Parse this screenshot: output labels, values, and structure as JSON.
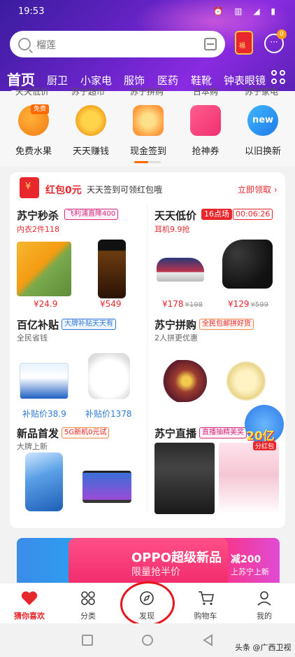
{
  "status": {
    "time": "19:53",
    "icons": "⏰ ▥ ◢ ▮"
  },
  "header": {
    "search_placeholder": "榴莲",
    "gift_label": "福",
    "msg_badge": "0"
  },
  "categories": [
    {
      "label": "首页"
    },
    {
      "label": "厨卫"
    },
    {
      "label": "小家电"
    },
    {
      "label": "服饰"
    },
    {
      "label": "医药"
    },
    {
      "label": "鞋靴"
    },
    {
      "label": "钟表眼镜"
    }
  ],
  "quick_top": [
    "天天低价",
    "苏宁超市",
    "苏宁拼购",
    "日本购",
    "苏宁家电"
  ],
  "quick": [
    {
      "label": "免费水果",
      "badge": "免费",
      "icon": "orange-fruit-icon"
    },
    {
      "label": "天天赚钱",
      "icon": "gold-coin-icon"
    },
    {
      "label": "现金签到",
      "icon": "diamond-icon"
    },
    {
      "label": "抢神券",
      "icon": "coupon-icon"
    },
    {
      "label": "以旧换新",
      "badge": "new",
      "icon": "new-icon"
    }
  ],
  "redpacket": {
    "amount": "红包0元",
    "text": "天天签到可领红包哦",
    "link": "立即领取 ›"
  },
  "sections": {
    "miaosha": {
      "title": "苏宁秒杀",
      "tag": "飞利浦直降400",
      "sub": "内衣2件118",
      "p1": "¥24.9",
      "p2": "¥549"
    },
    "dijia": {
      "title": "天天低价",
      "tag1": "16点场",
      "tag2": "00:06:26",
      "sub": "耳机9.9抢",
      "p1": "¥178",
      "o1": "¥198",
      "p2": "¥129",
      "o2": "¥599"
    },
    "butie": {
      "title": "百亿补贴",
      "tag": "大牌补贴天天有",
      "sub": "全民省钱",
      "p1": "补贴价38.9",
      "p2": "补贴价1378"
    },
    "pingou": {
      "title": "苏宁拼购",
      "tag": "全民包邮拼好货",
      "sub": "2人拼更优惠"
    },
    "shoufa": {
      "title": "新品首发",
      "tag": "5G新机0元试",
      "sub": "大牌上新"
    },
    "zhibo": {
      "title": "苏宁直播",
      "tag": "直播抽精美奖"
    }
  },
  "float_badge": {
    "text": "20亿",
    "sub": "分红包"
  },
  "promo": {
    "title": "OPPO超级新品",
    "subtitle": "限量抢半价",
    "right1": "减200",
    "right2": "上苏宁上新"
  },
  "tabs": [
    {
      "label": "猜你喜欢",
      "icon": "heart-icon"
    },
    {
      "label": "分类",
      "icon": "category-icon"
    },
    {
      "label": "发现",
      "icon": "compass-icon"
    },
    {
      "label": "购物车",
      "icon": "cart-icon"
    },
    {
      "label": "我的",
      "icon": "user-icon"
    }
  ],
  "watermark": "头条 @广西卫视",
  "colors": {
    "brand": "#e8272c",
    "header": "#6a24c9",
    "accent_blue": "#2f7ad6"
  }
}
